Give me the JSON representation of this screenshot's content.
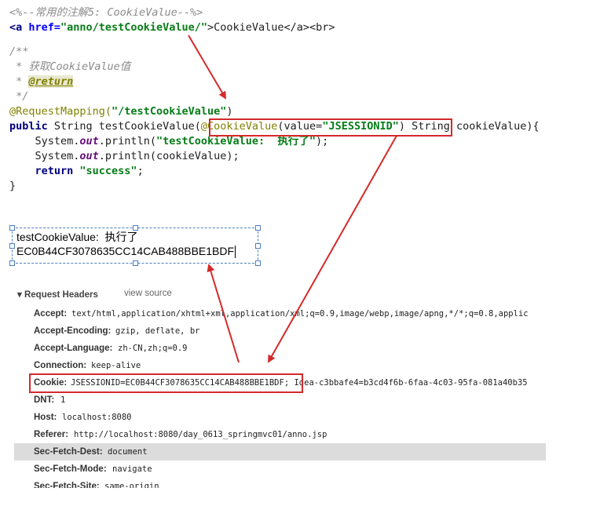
{
  "code": {
    "line1": "<%--常用的注解5: CookieValue--%>",
    "line2": {
      "open": "<a ",
      "href_attr": "href=",
      "href_value": "\"anno/testCookieValue/\"",
      "text": ">CookieValue</a><br>"
    },
    "doc1": "/**",
    "doc2": " * 获取CookieValue值",
    "doc3_prefix": " * ",
    "doc3_tag": "@return",
    "doc4": " */",
    "mapping": {
      "annotation": "@RequestMapping(",
      "value": "\"/testCookieValue\"",
      "close": ")"
    },
    "signature": {
      "kw": "public",
      "type": " String testCookieValue(",
      "ann": "@CookieValue",
      "param_open": "(value=",
      "param_value": "\"JSESSIONID\"",
      "param_close": ")",
      "rest": " String cookieValue){"
    },
    "print1": {
      "prefix": "    System.",
      "field": "out",
      "method": ".println(",
      "str": "\"testCookieValue:  执行了\"",
      "end": ");"
    },
    "print2": {
      "prefix": "    System.",
      "field": "out",
      "method": ".println(cookieValue);"
    },
    "ret": {
      "kw": "    return ",
      "str": "\"success\"",
      "end": ";"
    },
    "close": "}"
  },
  "output": {
    "line1": "testCookieValue:  执行了",
    "line2": "EC0B44CF3078635CC14CAB488BBE1BDF"
  },
  "devtools": {
    "section_title": "▾ Request Headers",
    "view_source": "view source",
    "headers": [
      {
        "key": "Accept:",
        "value": "text/html,application/xhtml+xml,application/xml;q=0.9,image/webp,image/apng,*/*;q=0.8,applic"
      },
      {
        "key": "Accept-Encoding:",
        "value": "gzip, deflate, br"
      },
      {
        "key": "Accept-Language:",
        "value": "zh-CN,zh;q=0.9"
      },
      {
        "key": "Connection:",
        "value": "keep-alive"
      },
      {
        "key": "Cookie:",
        "value": "JSESSIONID=EC0B44CF3078635CC14CAB488BBE1BDF;",
        "extra": " Idea-c3bbafe4=b3cd4f6b-6faa-4c03-95fa-081a40b35"
      },
      {
        "key": "DNT:",
        "value": "1"
      },
      {
        "key": "Host:",
        "value": "localhost:8080"
      },
      {
        "key": "Referer:",
        "value": "http://localhost:8080/day_0613_springmvc01/anno.jsp"
      },
      {
        "key": "Sec-Fetch-Dest:",
        "value": "document"
      },
      {
        "key": "Sec-Fetch-Mode:",
        "value": "navigate"
      },
      {
        "key": "Sec-Fetch-Site:",
        "value": "same-origin"
      }
    ]
  },
  "colors": {
    "annotation_red": "#d42a2a",
    "selection_blue": "#4a7fbf",
    "highlight_row": "#dcdcdc"
  }
}
